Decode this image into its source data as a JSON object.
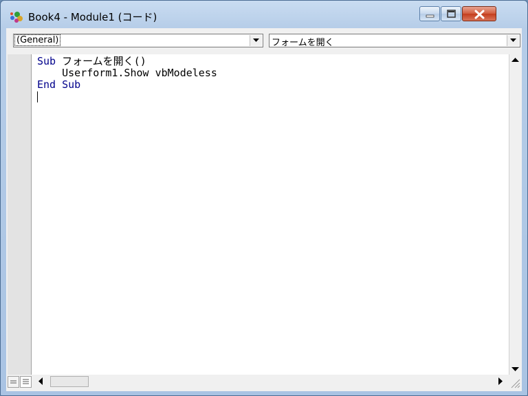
{
  "window": {
    "title": "Book4 - Module1 (コード)",
    "icon": "vba-project-icon",
    "buttons": {
      "minimize": "minimize-icon",
      "maximize": "maximize-icon",
      "close": "close-icon"
    }
  },
  "toolbar": {
    "object_combo": "(General)",
    "procedure_combo": "フォームを開く"
  },
  "code": {
    "lines": [
      {
        "kw1": "Sub",
        "rest": " フォームを開く()"
      },
      {
        "indent": "    ",
        "text": "Userform1.Show vbModeless"
      },
      {
        "kw1": "End",
        "kw2": "Sub"
      }
    ]
  },
  "colors": {
    "keyword": "#00008b",
    "caption_close": "#c43d1c"
  }
}
